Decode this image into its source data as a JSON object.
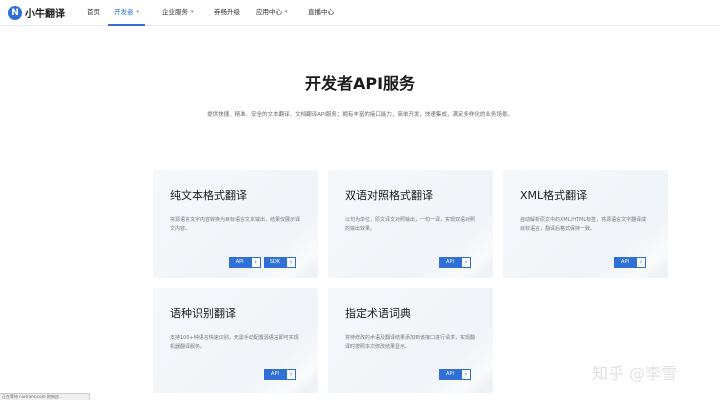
{
  "brand": {
    "name": "小牛翻译",
    "mark": "N",
    "color": "#2f6fd6"
  },
  "nav": {
    "items": [
      {
        "label": "首页",
        "has_menu": false,
        "active": false
      },
      {
        "label": "开发者",
        "has_menu": true,
        "active": true
      },
      {
        "label": "企业服务",
        "has_menu": true,
        "active": false
      },
      {
        "label": "券畅升级",
        "has_menu": false,
        "active": false
      },
      {
        "label": "应用中心",
        "has_menu": true,
        "active": false
      },
      {
        "label": "直播中心",
        "has_menu": false,
        "active": false
      }
    ]
  },
  "hero": {
    "title": "开发者API服务",
    "subtitle": "提供快捷、精准、安全的文本翻译、文档翻译API服务；拥有丰富的接口能力，简单开发，快速集成，满足多样化的业务场景。"
  },
  "cards": [
    {
      "title": "纯文本格式翻译",
      "desc": "将源语言文字内容转换为目标语言文本输出，结果仅展示译文内容。",
      "buttons": [
        "API",
        "SDK"
      ]
    },
    {
      "title": "双语对照格式翻译",
      "desc": "以句为单位，原文译文对照输出，一句一译，实现双语对照的输出效果。",
      "buttons": [
        "API"
      ]
    },
    {
      "title": "XML格式翻译",
      "desc": "自动解析原文中的XML/HTML标签，将源语言文字翻译成目标语言，翻译后格式保持一致。",
      "buttons": [
        "API"
      ]
    },
    {
      "title": "语种识别翻译",
      "desc": "支持100+种语言快速识别，无需手动配置源语言即可实现机器翻译服务。",
      "buttons": [
        "API"
      ]
    },
    {
      "title": "指定术语词典",
      "desc": "将待修改的术语及翻译结果添加到该接口进行请求，实现翻译时按照本次修改结果显示。",
      "buttons": [
        "API"
      ]
    }
  ],
  "watermark": "知乎 @李雪",
  "status_bar": "正在等待 niutrans.com 的响应..."
}
